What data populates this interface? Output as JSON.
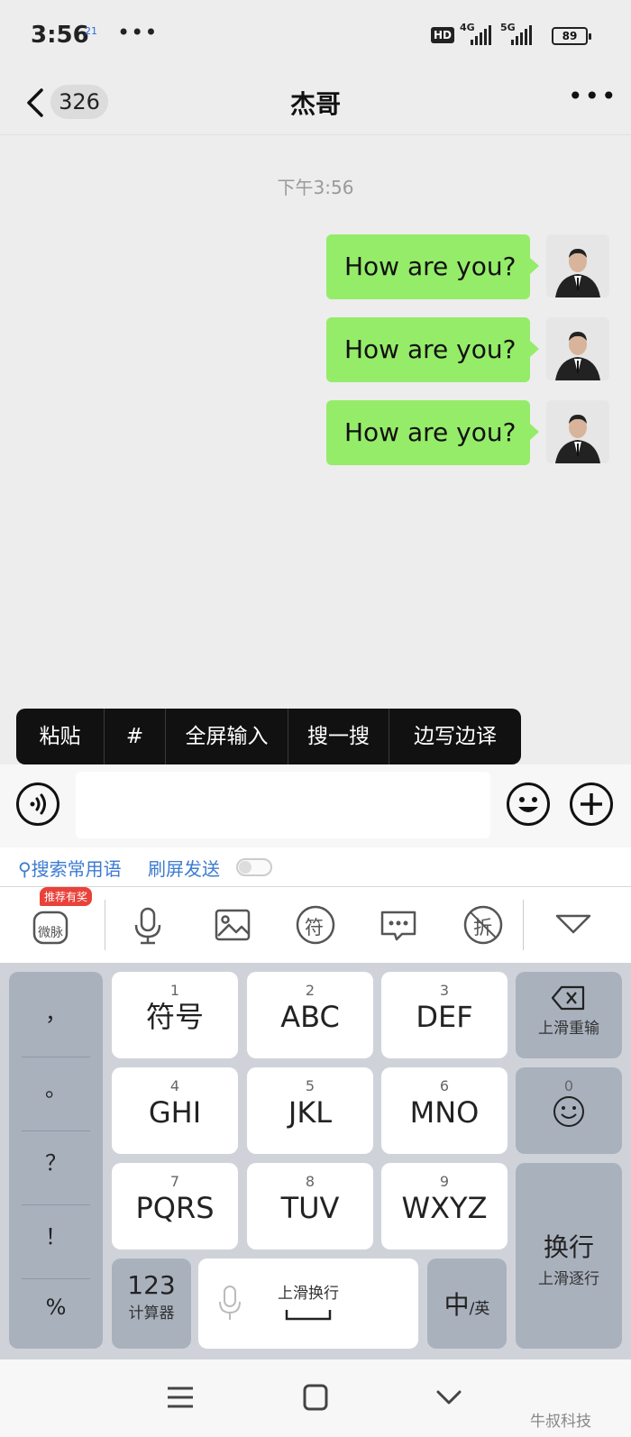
{
  "status_bar": {
    "time": "3:56",
    "notif_badge": "21",
    "overflow": "•••",
    "hd": "HD",
    "sim1": "4G",
    "sim2": "5G",
    "battery": "89"
  },
  "header": {
    "unread_count": "326",
    "title": "杰哥",
    "more": "•••"
  },
  "chat": {
    "timestamp": "下午3:56",
    "messages": [
      {
        "text": "How are you?"
      },
      {
        "text": "How are you?"
      },
      {
        "text": "How are you?"
      }
    ]
  },
  "context_menu": {
    "items": [
      "粘贴",
      "#",
      "全屏输入",
      "搜一搜",
      "边写边译"
    ]
  },
  "input": {
    "placeholder": ""
  },
  "suggestions": {
    "search_phrases": "搜索常用语",
    "swipe_send": "刷屏发送"
  },
  "toolbar": {
    "promo_badge": "推荐有奖",
    "weimai_label": "微脉",
    "symbol_label": "符",
    "discount_label": "折"
  },
  "keyboard": {
    "punctuation": [
      "，",
      "。",
      "？",
      "！",
      "%"
    ],
    "keys": [
      {
        "num": "1",
        "label": "符号"
      },
      {
        "num": "2",
        "label": "ABC"
      },
      {
        "num": "3",
        "label": "DEF"
      },
      {
        "num": "4",
        "label": "GHI"
      },
      {
        "num": "5",
        "label": "JKL"
      },
      {
        "num": "6",
        "label": "MNO"
      },
      {
        "num": "7",
        "label": "PQRS"
      },
      {
        "num": "8",
        "label": "TUV"
      },
      {
        "num": "9",
        "label": "WXYZ"
      }
    ],
    "backspace_sub": "上滑重输",
    "emoji_num": "0",
    "enter_label": "换行",
    "enter_sub": "上滑逐行",
    "calc_label": "123",
    "calc_sub": "计算器",
    "space_sub": "上滑换行",
    "lang_main": "中",
    "lang_sub": "/英"
  },
  "watermark": "牛叔科技"
}
